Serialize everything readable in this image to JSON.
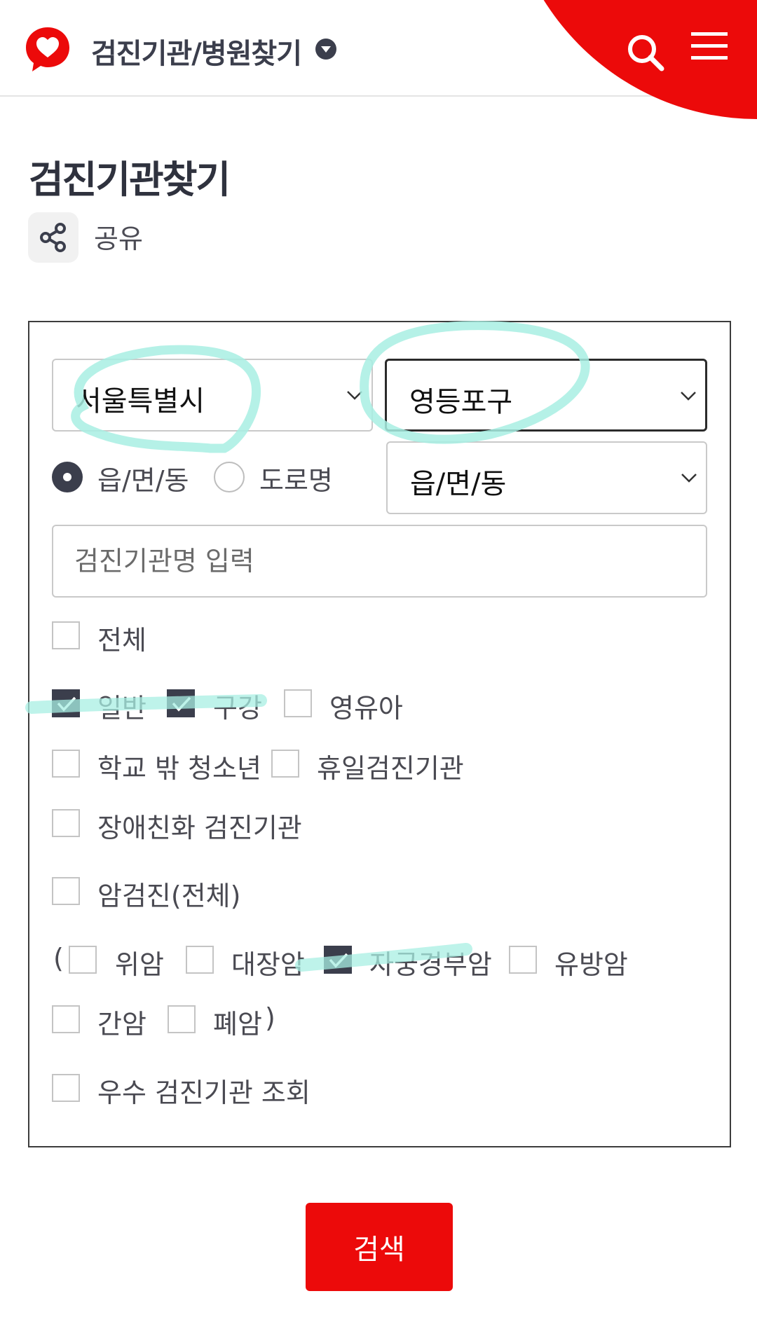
{
  "header": {
    "title": "검진기관/병원찾기",
    "brand_color": "#ec0a0a",
    "icons": [
      "heart-logo-icon",
      "caret-down-circle-icon",
      "search-icon",
      "hamburger-menu-icon"
    ]
  },
  "page": {
    "title": "검진기관찾기",
    "share_label": "공유"
  },
  "form": {
    "region_select": {
      "value": "서울특별시"
    },
    "district_select": {
      "value": "영등포구"
    },
    "address_type": {
      "options": [
        "읍/면/동",
        "도로명"
      ],
      "selected": "읍/면/동"
    },
    "neighborhood_select": {
      "value": "읍/면/동"
    },
    "name_input": {
      "placeholder": "검진기관명 입력",
      "value": ""
    },
    "checkboxes": {
      "all": {
        "label": "전체",
        "checked": false
      },
      "general": {
        "label": "일반",
        "checked": true
      },
      "oral": {
        "label": "구강",
        "checked": true
      },
      "infant": {
        "label": "영유아",
        "checked": false
      },
      "out_of_school": {
        "label": "학교 밖 청소년",
        "checked": false
      },
      "holiday": {
        "label": "휴일검진기관",
        "checked": false
      },
      "disability_friendly": {
        "label": "장애친화 검진기관",
        "checked": false
      },
      "cancer_all": {
        "label": "암검진(전체)",
        "checked": false
      },
      "stomach": {
        "label": "위암",
        "checked": false
      },
      "colon": {
        "label": "대장암",
        "checked": false
      },
      "cervical": {
        "label": "자궁경부암",
        "checked": true
      },
      "breast": {
        "label": "유방암",
        "checked": false
      },
      "liver": {
        "label": "간암",
        "checked": false
      },
      "lung": {
        "label": "폐암",
        "checked": false
      },
      "excellent": {
        "label": "우수 검진기관 조회",
        "checked": false
      }
    },
    "paren_open": "(",
    "paren_close": ")"
  },
  "search_button": {
    "label": "검색"
  }
}
